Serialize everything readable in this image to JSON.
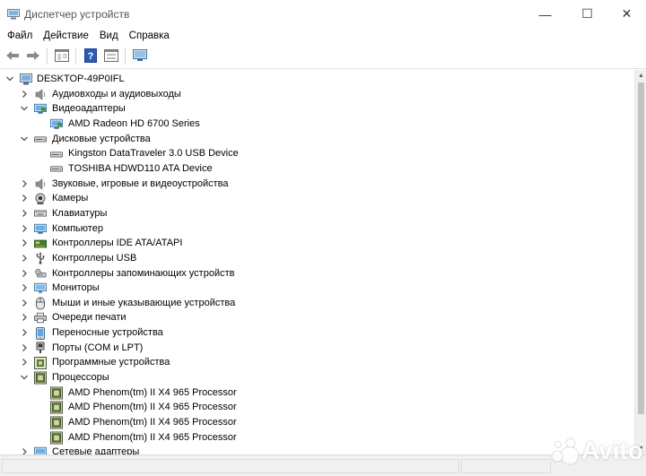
{
  "window": {
    "title": "Диспетчер устройств",
    "minimize_glyph": "—",
    "maximize_glyph": "☐",
    "close_glyph": "✕"
  },
  "menu": [
    "Файл",
    "Действие",
    "Вид",
    "Справка"
  ],
  "toolbar": {
    "buttons": [
      "back-arrow-icon",
      "forward-arrow-icon",
      "properties-panel-icon",
      "help-icon",
      "properties-sheet-icon",
      "monitor-scan-icon"
    ]
  },
  "tree": {
    "root": "DESKTOP-49P0IFL",
    "items": [
      {
        "label": "Аудиовходы и аудиовыходы",
        "level": 1,
        "expander": "collapsed",
        "icon": "speaker-icon"
      },
      {
        "label": "Видеоадаптеры",
        "level": 1,
        "expander": "expanded",
        "icon": "display-adapter-icon"
      },
      {
        "label": "AMD Radeon HD 6700 Series",
        "level": 2,
        "expander": "none",
        "icon": "display-adapter-icon"
      },
      {
        "label": "Дисковые устройства",
        "level": 1,
        "expander": "expanded",
        "icon": "disk-drive-icon"
      },
      {
        "label": "Kingston DataTraveler 3.0 USB Device",
        "level": 2,
        "expander": "none",
        "icon": "disk-drive-icon"
      },
      {
        "label": "TOSHIBA HDWD110 ATA Device",
        "level": 2,
        "expander": "none",
        "icon": "disk-drive-icon"
      },
      {
        "label": "Звуковые, игровые и видеоустройства",
        "level": 1,
        "expander": "collapsed",
        "icon": "speaker-icon"
      },
      {
        "label": "Камеры",
        "level": 1,
        "expander": "collapsed",
        "icon": "camera-icon"
      },
      {
        "label": "Клавиатуры",
        "level": 1,
        "expander": "collapsed",
        "icon": "keyboard-icon"
      },
      {
        "label": "Компьютер",
        "level": 1,
        "expander": "collapsed",
        "icon": "computer-icon"
      },
      {
        "label": "Контроллеры IDE ATA/ATAPI",
        "level": 1,
        "expander": "collapsed",
        "icon": "ide-controller-icon"
      },
      {
        "label": "Контроллеры USB",
        "level": 1,
        "expander": "collapsed",
        "icon": "usb-icon"
      },
      {
        "label": "Контроллеры запоминающих устройств",
        "level": 1,
        "expander": "collapsed",
        "icon": "storage-controller-icon"
      },
      {
        "label": "Мониторы",
        "level": 1,
        "expander": "collapsed",
        "icon": "monitor-icon"
      },
      {
        "label": "Мыши и иные указывающие устройства",
        "level": 1,
        "expander": "collapsed",
        "icon": "mouse-icon"
      },
      {
        "label": "Очереди печати",
        "level": 1,
        "expander": "collapsed",
        "icon": "printer-icon"
      },
      {
        "label": "Переносные устройства",
        "level": 1,
        "expander": "collapsed",
        "icon": "portable-device-icon"
      },
      {
        "label": "Порты (COM и LPT)",
        "level": 1,
        "expander": "collapsed",
        "icon": "port-icon"
      },
      {
        "label": "Программные устройства",
        "level": 1,
        "expander": "collapsed",
        "icon": "software-device-icon"
      },
      {
        "label": "Процессоры",
        "level": 1,
        "expander": "expanded",
        "icon": "processor-icon"
      },
      {
        "label": "AMD Phenom(tm) II X4 965 Processor",
        "level": 2,
        "expander": "none",
        "icon": "processor-icon"
      },
      {
        "label": "AMD Phenom(tm) II X4 965 Processor",
        "level": 2,
        "expander": "none",
        "icon": "processor-icon"
      },
      {
        "label": "AMD Phenom(tm) II X4 965 Processor",
        "level": 2,
        "expander": "none",
        "icon": "processor-icon"
      },
      {
        "label": "AMD Phenom(tm) II X4 965 Processor",
        "level": 2,
        "expander": "none",
        "icon": "processor-icon"
      },
      {
        "label": "Сетевые адаптеры",
        "level": 1,
        "expander": "collapsed",
        "icon": "network-adapter-icon"
      }
    ]
  },
  "watermark": {
    "text": "Avito"
  },
  "colors": {
    "chevron": "#555555",
    "text": "#000000",
    "accent_blue": "#2b78c2",
    "processor_green": "#6a8a3a"
  }
}
